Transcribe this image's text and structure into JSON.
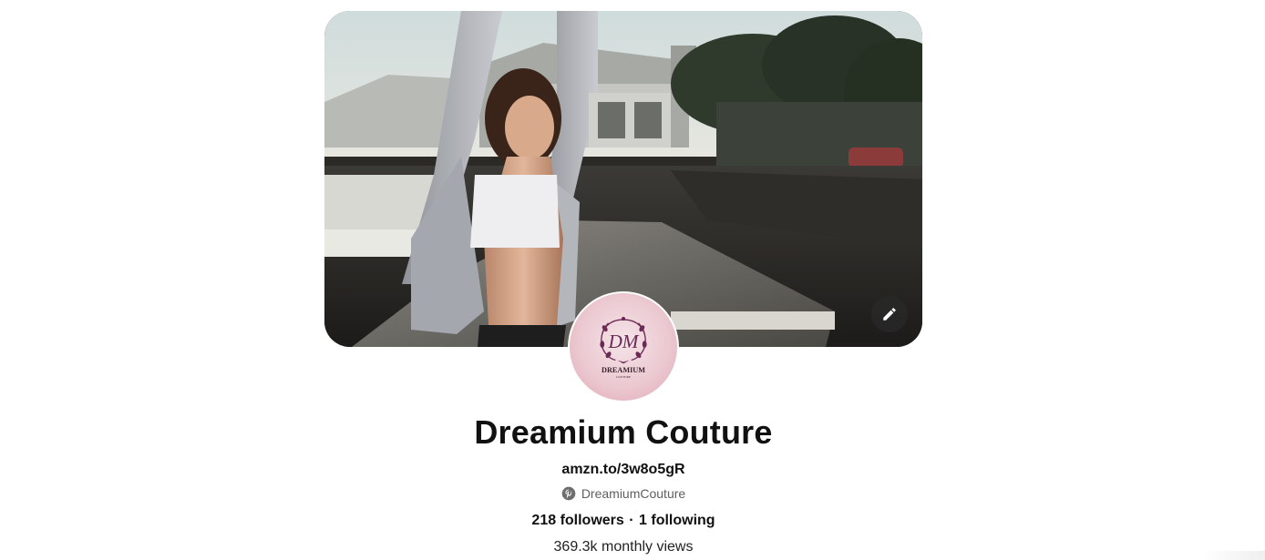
{
  "profile": {
    "name": "Dreamium Couture",
    "website": "amzn.to/3w8o5gR",
    "handle": "DreamiumCouture",
    "followers": "218 followers",
    "separator": "·",
    "following": "1 following",
    "monthly_views": "369.3k monthly views"
  },
  "avatar": {
    "logo_monogram": "DM",
    "logo_name": "DREAMIUM",
    "logo_sub": "COUTURE"
  },
  "icons": {
    "edit": "pencil-icon",
    "handle": "pinterest-icon"
  },
  "colors": {
    "text_primary": "#111111",
    "text_secondary": "#5f5f5f",
    "avatar_bg": "#ecc9d1",
    "logo_accent": "#6b2a55",
    "edit_button_bg": "#282828"
  }
}
